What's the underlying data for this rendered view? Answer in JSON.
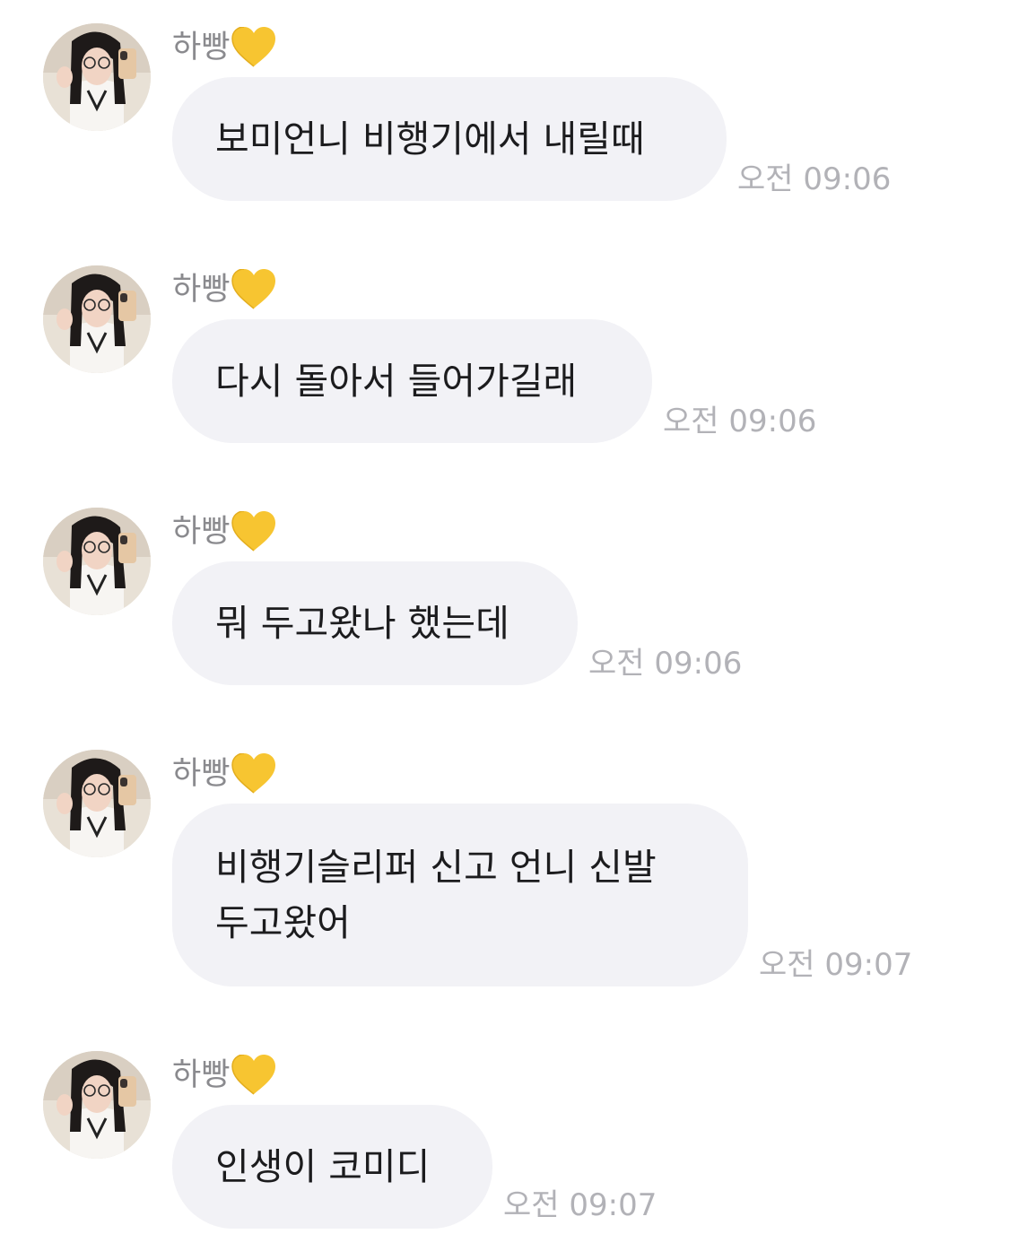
{
  "chat": {
    "messages": [
      {
        "sender": "하빵",
        "avatar": "profile-photo",
        "badge_icon": "yellow-heart-icon",
        "text": "보미언니 비행기에서 내릴때",
        "time": "오전 09:06"
      },
      {
        "sender": "하빵",
        "avatar": "profile-photo",
        "badge_icon": "yellow-heart-icon",
        "text": "다시 돌아서 들어가길래",
        "time": "오전 09:06"
      },
      {
        "sender": "하빵",
        "avatar": "profile-photo",
        "badge_icon": "yellow-heart-icon",
        "text": "뭐 두고왔나 했는데",
        "time": "오전 09:06"
      },
      {
        "sender": "하빵",
        "avatar": "profile-photo",
        "badge_icon": "yellow-heart-icon",
        "text_lines": [
          "비행기슬리퍼 신고 언니 신발",
          "두고왔어"
        ],
        "time": "오전 09:07"
      },
      {
        "sender": "하빵",
        "avatar": "profile-photo",
        "badge_icon": "yellow-heart-icon",
        "text": "인생이 코미디",
        "time": "오전 09:07"
      }
    ]
  },
  "colors": {
    "bubble": "#f2f2f6",
    "message_text": "#1c1c1e",
    "sender_name": "#8a8a8e",
    "timestamp": "#b2b2b7",
    "heart": "#f7c531"
  }
}
